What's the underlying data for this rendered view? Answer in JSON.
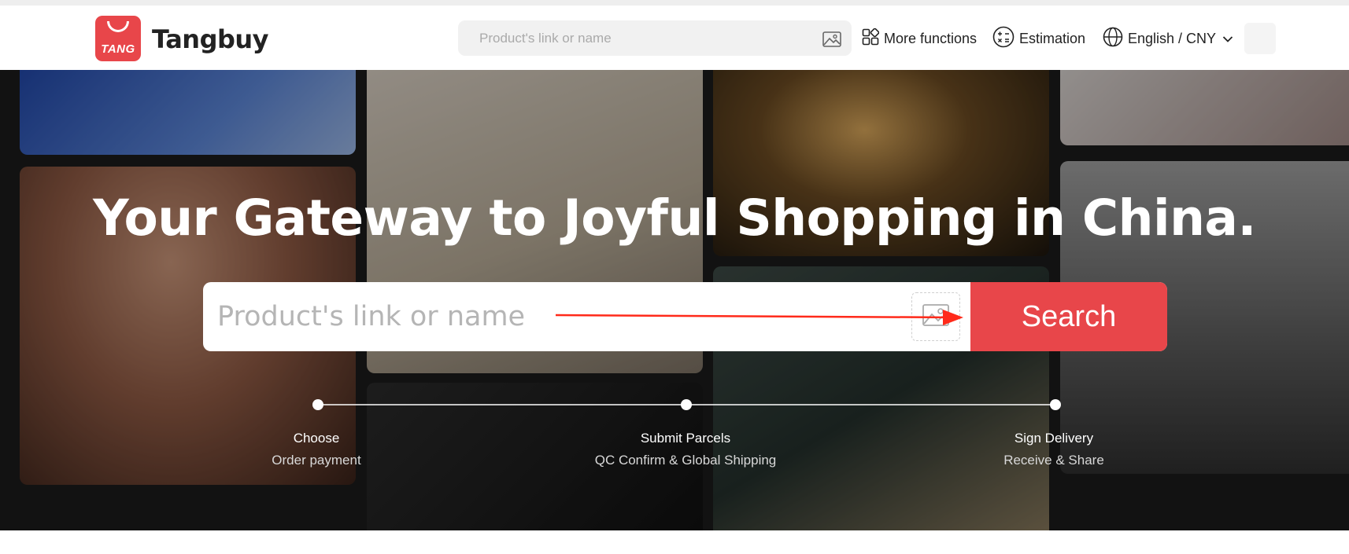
{
  "brand": {
    "logo_text": "TANG",
    "name": "Tangbuy",
    "accent": "#e8464a"
  },
  "nav": {
    "search_placeholder": "Product's link or name",
    "more_functions": "More functions",
    "estimation": "Estimation",
    "language_currency": "English / CNY"
  },
  "hero": {
    "title": "Your Gateway to Joyful Shopping in China.",
    "search_placeholder": "Product's link or name",
    "search_button": "Search",
    "steps": [
      {
        "title": "Choose",
        "subtitle": "Order payment"
      },
      {
        "title": "Submit Parcels",
        "subtitle": "QC Confirm & Global Shipping"
      },
      {
        "title": "Sign Delivery",
        "subtitle": "Receive & Share"
      }
    ]
  },
  "annotation": {
    "arrow_color": "#ff2a1a"
  },
  "icons": [
    "image-search-icon",
    "grid-icon",
    "calculator-icon",
    "globe-icon",
    "chevron-down-icon",
    "avatar"
  ]
}
